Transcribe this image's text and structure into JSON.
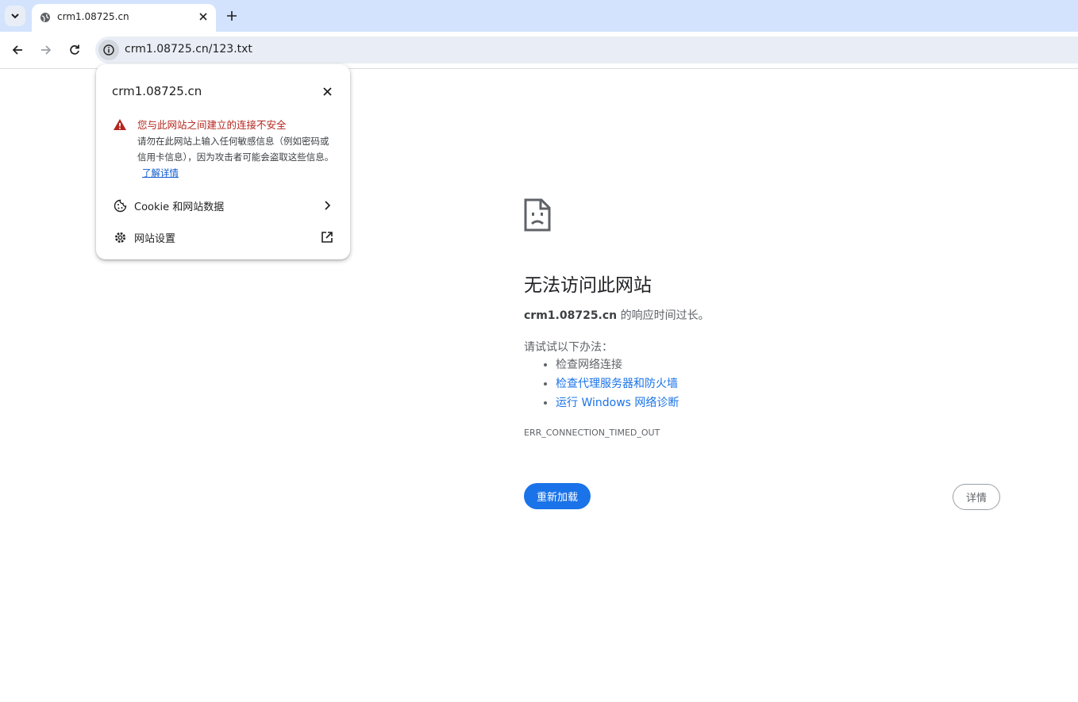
{
  "tab": {
    "title": "crm1.08725.cn"
  },
  "omnibox": {
    "url": "crm1.08725.cn/123.txt"
  },
  "popup": {
    "host": "crm1.08725.cn",
    "warning_title": "您与此网站之间建立的连接不安全",
    "warning_body": "请勿在此网站上输入任何敏感信息（例如密码或信用卡信息），因为攻击者可能会盗取这些信息。",
    "learn_more": "了解详情",
    "cookie_label": "Cookie 和网站数据",
    "settings_label": "网站设置"
  },
  "error": {
    "title": "无法访问此网站",
    "host": "crm1.08725.cn",
    "desc_suffix": " 的响应时间过长。",
    "try_label": "请试试以下办法：",
    "suggestions": [
      "检查网络连接",
      "检查代理服务器和防火墙",
      "运行 Windows 网络诊断"
    ],
    "code": "ERR_CONNECTION_TIMED_OUT",
    "reload_label": "重新加载",
    "details_label": "详情"
  },
  "colors": {
    "accent": "#1a73e8",
    "warning": "#b3261e",
    "tabstrip": "#d3e3fd",
    "omnibox": "#e9eef6"
  },
  "icons": [
    "tab-search-icon",
    "globe-icon",
    "close-icon",
    "plus-icon",
    "back-icon",
    "forward-icon",
    "reload-icon",
    "info-icon",
    "warning-icon",
    "cookie-icon",
    "gear-icon",
    "chevron-right-icon",
    "external-link-icon",
    "sad-page-icon"
  ]
}
